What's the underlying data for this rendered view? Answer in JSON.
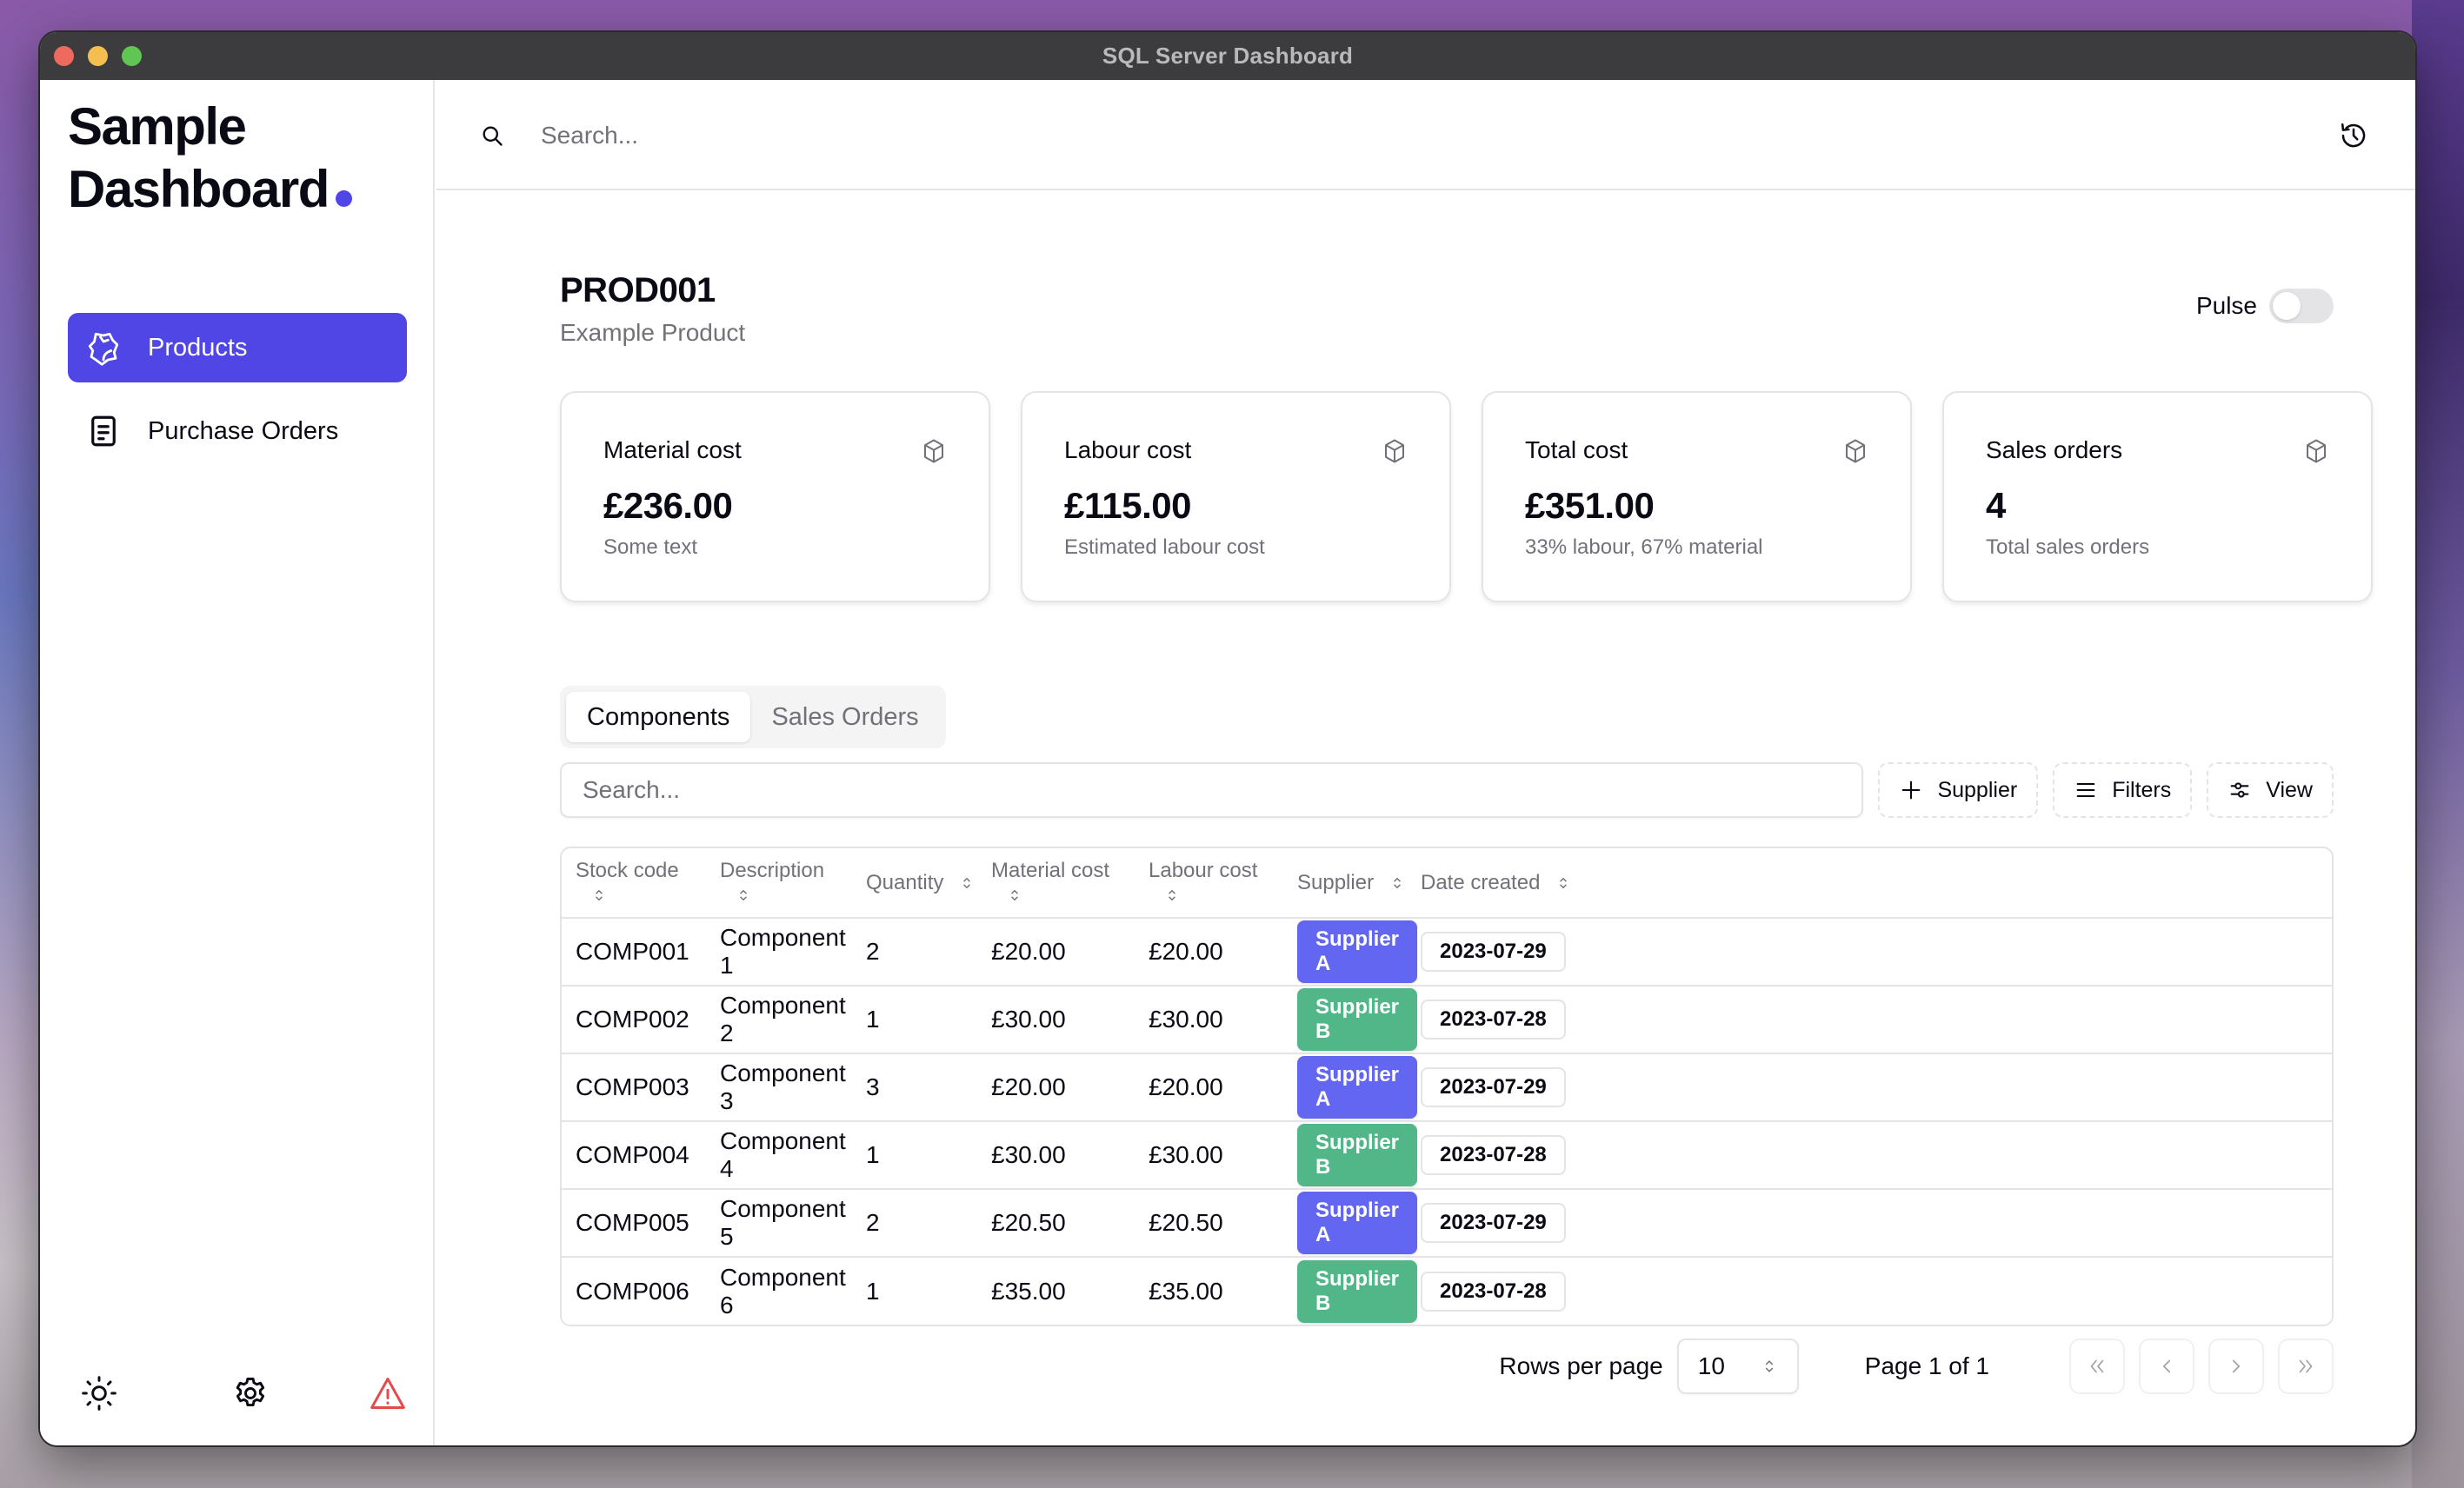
{
  "window": {
    "title": "SQL Server Dashboard"
  },
  "sidebar": {
    "brand_line1": "Sample",
    "brand_line2": "Dashboard",
    "brand_accent": "#4f46e5",
    "items": [
      {
        "label": "Products",
        "icon": "products-icon",
        "active": true
      },
      {
        "label": "Purchase Orders",
        "icon": "document-icon",
        "active": false
      }
    ],
    "footer_icons": [
      "sun-icon",
      "gear-icon",
      "warning-icon"
    ]
  },
  "topbar": {
    "search_placeholder": "Search...",
    "history_icon": "history-icon"
  },
  "product": {
    "code": "PROD001",
    "name": "Example Product",
    "pulse_label": "Pulse",
    "pulse_on": false
  },
  "cards": [
    {
      "title": "Material cost",
      "value": "£236.00",
      "sub": "Some text",
      "icon": "cube-icon"
    },
    {
      "title": "Labour cost",
      "value": "£115.00",
      "sub": "Estimated labour cost",
      "icon": "cube-icon"
    },
    {
      "title": "Total cost",
      "value": "£351.00",
      "sub": "33% labour, 67% material",
      "icon": "cube-icon"
    },
    {
      "title": "Sales orders",
      "value": "4",
      "sub": "Total sales orders",
      "icon": "cube-icon"
    }
  ],
  "tabs": [
    {
      "label": "Components",
      "active": true
    },
    {
      "label": "Sales Orders",
      "active": false
    }
  ],
  "toolbar": {
    "search_placeholder": "Search...",
    "supplier_label": "Supplier",
    "filters_label": "Filters",
    "view_label": "View"
  },
  "table": {
    "columns": [
      "Stock code",
      "Description",
      "Quantity",
      "Material cost",
      "Labour cost",
      "Supplier",
      "Date created"
    ],
    "rows": [
      {
        "stock_code": "COMP001",
        "description": "Component 1",
        "quantity": "2",
        "material_cost": "£20.00",
        "labour_cost": "£20.00",
        "supplier": "Supplier A",
        "date": "2023-07-29"
      },
      {
        "stock_code": "COMP002",
        "description": "Component 2",
        "quantity": "1",
        "material_cost": "£30.00",
        "labour_cost": "£30.00",
        "supplier": "Supplier B",
        "date": "2023-07-28"
      },
      {
        "stock_code": "COMP003",
        "description": "Component 3",
        "quantity": "3",
        "material_cost": "£20.00",
        "labour_cost": "£20.00",
        "supplier": "Supplier A",
        "date": "2023-07-29"
      },
      {
        "stock_code": "COMP004",
        "description": "Component 4",
        "quantity": "1",
        "material_cost": "£30.00",
        "labour_cost": "£30.00",
        "supplier": "Supplier B",
        "date": "2023-07-28"
      },
      {
        "stock_code": "COMP005",
        "description": "Component 5",
        "quantity": "2",
        "material_cost": "£20.50",
        "labour_cost": "£20.50",
        "supplier": "Supplier A",
        "date": "2023-07-29"
      },
      {
        "stock_code": "COMP006",
        "description": "Component 6",
        "quantity": "1",
        "material_cost": "£35.00",
        "labour_cost": "£35.00",
        "supplier": "Supplier B",
        "date": "2023-07-28"
      }
    ],
    "supplier_colors": {
      "Supplier A": "#6366f1",
      "Supplier B": "#52b788"
    }
  },
  "pagination": {
    "rows_per_page_label": "Rows per page",
    "rows_per_page_value": "10",
    "page_info": "Page 1 of 1"
  }
}
